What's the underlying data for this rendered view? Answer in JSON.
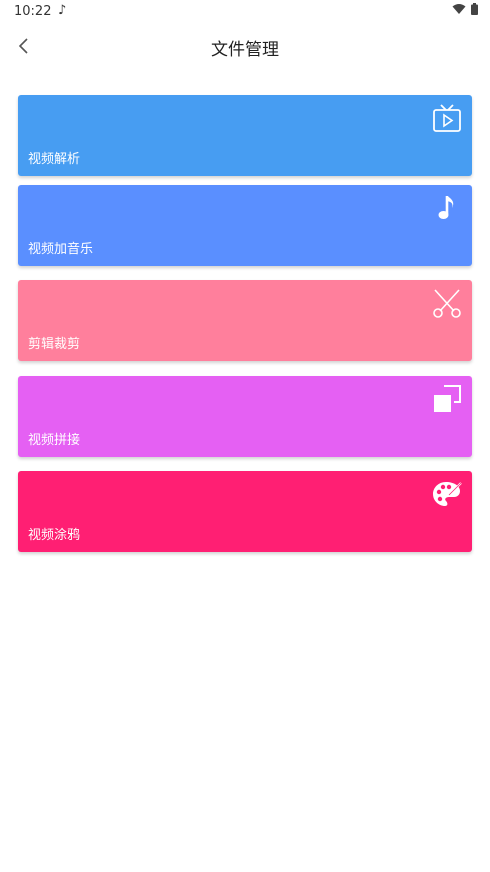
{
  "status_bar": {
    "time": "10:22",
    "note_glyph": "♪"
  },
  "header": {
    "title": "文件管理",
    "back_icon": "chevron-left-icon"
  },
  "cards": [
    {
      "label": "视频解析",
      "icon": "tv-play-icon",
      "color": "#479df2"
    },
    {
      "label": "视频加音乐",
      "icon": "music-note-icon",
      "color": "#5a8fff"
    },
    {
      "label": "剪辑裁剪",
      "icon": "scissors-icon",
      "color": "#ff7f9c"
    },
    {
      "label": "视频拼接",
      "icon": "copy-squares-icon",
      "color": "#e560f3"
    },
    {
      "label": "视频涂鸦",
      "icon": "palette-icon",
      "color": "#ff1f73"
    }
  ]
}
